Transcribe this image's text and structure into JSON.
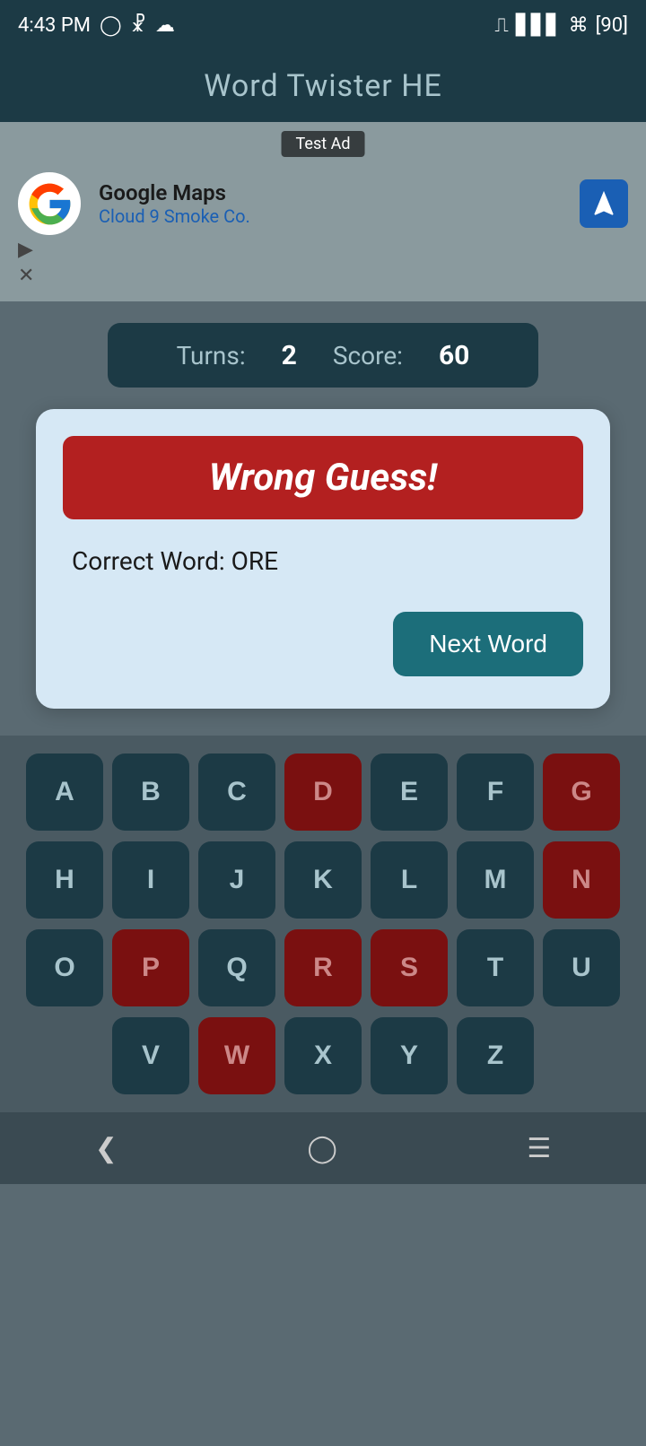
{
  "statusBar": {
    "time": "4:43 PM",
    "battery": "90"
  },
  "titleBar": {
    "title": "Word Twister HE"
  },
  "ad": {
    "label": "Test Ad",
    "title": "Google Maps",
    "subtitle": "Cloud 9 Smoke Co."
  },
  "scoreBar": {
    "turnsLabel": "Turns:",
    "turnsValue": "2",
    "scoreLabel": "Score:",
    "scoreValue": "60"
  },
  "modal": {
    "wrongGuessLabel": "Wrong Guess!",
    "correctWordLabel": "Correct Word: ORE",
    "nextWordLabel": "Next Word"
  },
  "keyboard": {
    "rows": [
      [
        "A",
        "B",
        "C",
        "D",
        "E",
        "F",
        "G"
      ],
      [
        "H",
        "I",
        "J",
        "K",
        "L",
        "M",
        "N"
      ],
      [
        "O",
        "P",
        "Q",
        "R",
        "S",
        "T",
        "U"
      ],
      [
        "V",
        "W",
        "X",
        "Y",
        "Z"
      ]
    ],
    "usedKeys": [
      "D",
      "G",
      "N",
      "P",
      "R",
      "S",
      "W"
    ]
  }
}
